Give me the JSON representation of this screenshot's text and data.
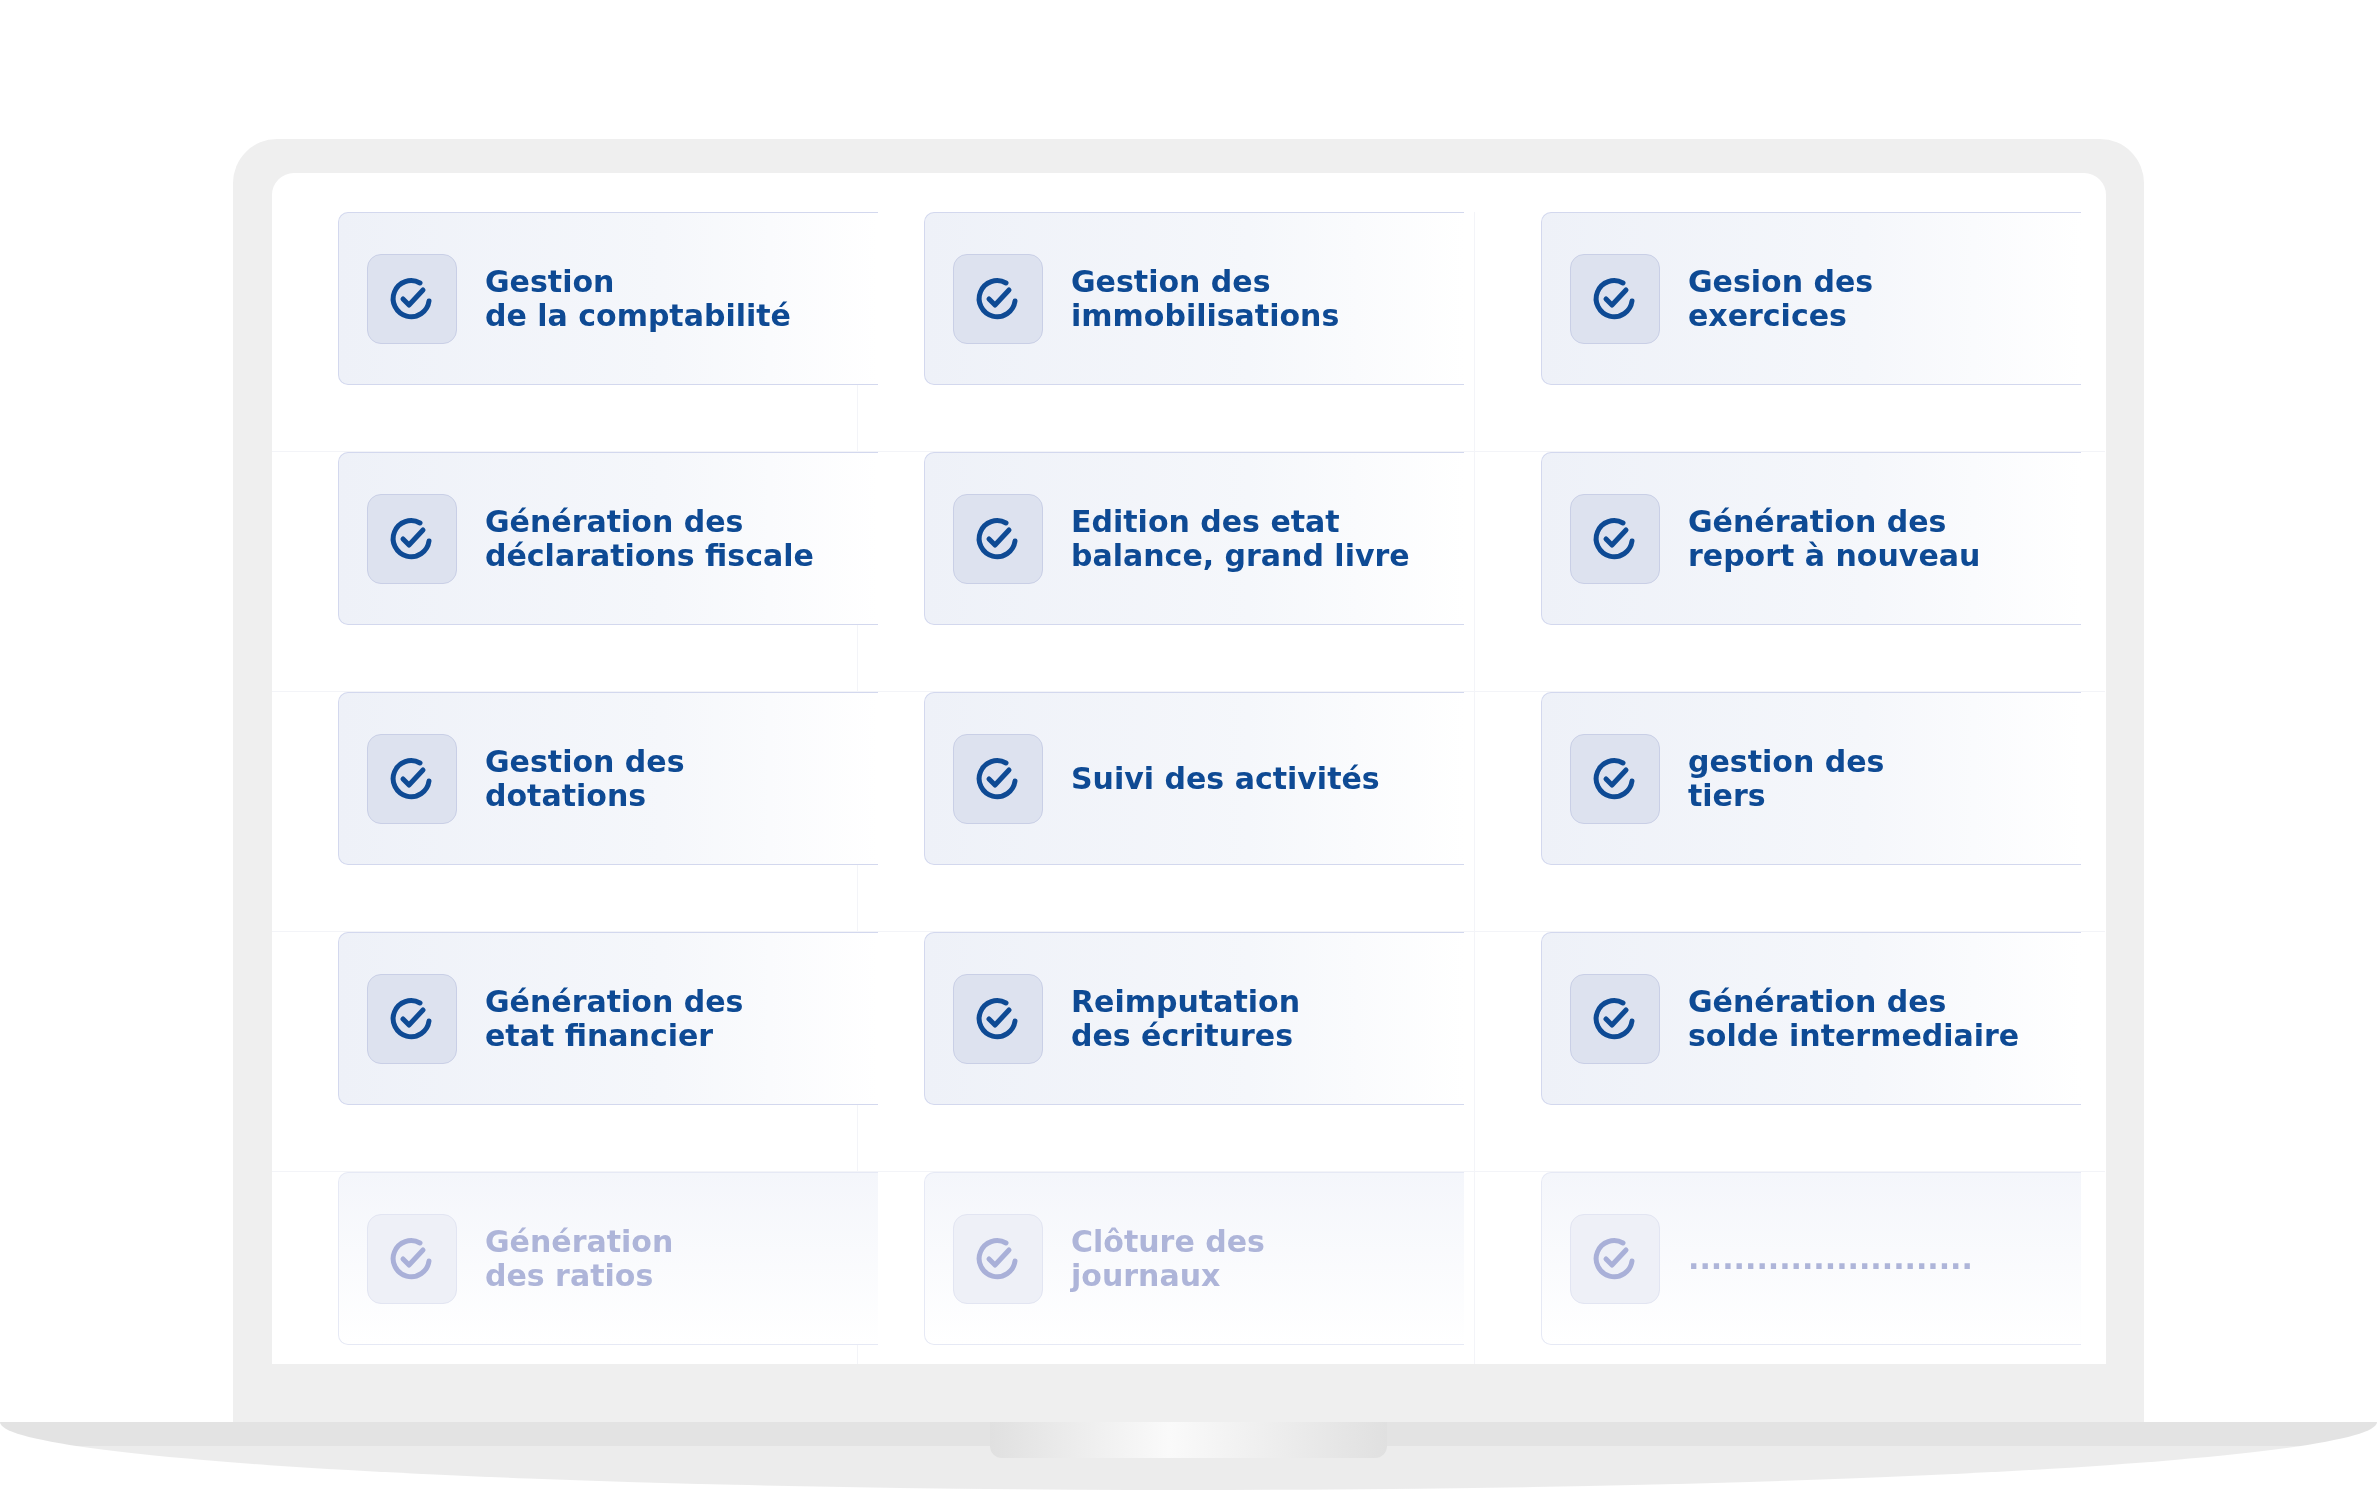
{
  "features": [
    {
      "label": "Gestion\nde la comptabilité",
      "disabled": false
    },
    {
      "label": "Gestion des\nimmobilisations",
      "disabled": false
    },
    {
      "label": "Gesion des\nexercices",
      "disabled": false
    },
    {
      "label": "Génération des\ndéclarations fiscale",
      "disabled": false
    },
    {
      "label": "Edition des etat\nbalance, grand livre",
      "disabled": false
    },
    {
      "label": "Génération des\nreport à nouveau",
      "disabled": false
    },
    {
      "label": "Gestion des\ndotations",
      "disabled": false
    },
    {
      "label": "Suivi des activités",
      "disabled": false
    },
    {
      "label": "gestion des\ntiers",
      "disabled": false
    },
    {
      "label": "Génération des\netat financier",
      "disabled": false
    },
    {
      "label": "Reimputation\ndes écritures",
      "disabled": false
    },
    {
      "label": "Génération des\nsolde intermediaire",
      "disabled": false
    },
    {
      "label": "Génération\ndes ratios",
      "disabled": true
    },
    {
      "label": "Clôture des\njournaux",
      "disabled": true
    },
    {
      "label": ".........................",
      "disabled": true
    }
  ]
}
